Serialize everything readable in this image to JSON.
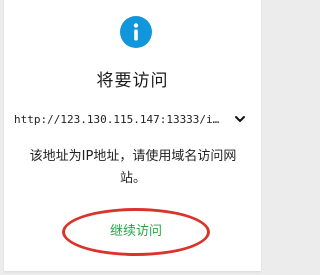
{
  "dialog": {
    "icon": "info-icon",
    "title": "将要访问",
    "url": "http://123.130.115.147:13333/i…",
    "url_toggle_icon": "chevron-down-icon",
    "message": "该地址为IP地址，请使用域名访问网站。",
    "continue_label": "继续访问"
  },
  "colors": {
    "icon_blue": "#1296db",
    "continue_green": "#26a544",
    "highlight_red": "#d9342b"
  }
}
